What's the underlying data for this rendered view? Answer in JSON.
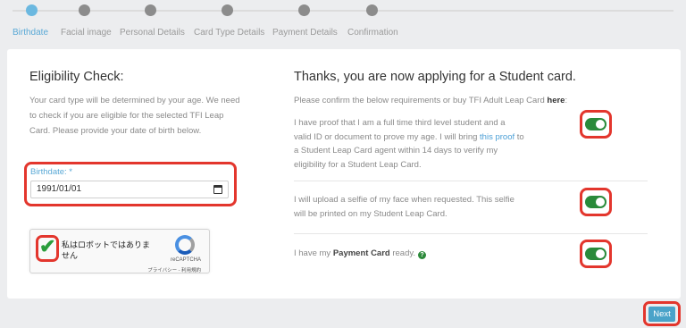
{
  "stepper": {
    "steps": [
      {
        "label": "Birthdate",
        "active": true
      },
      {
        "label": "Facial image",
        "active": false
      },
      {
        "label": "Personal Details",
        "active": false
      },
      {
        "label": "Card Type Details",
        "active": false
      },
      {
        "label": "Payment Details",
        "active": false
      },
      {
        "label": "Confirmation",
        "active": false
      }
    ]
  },
  "eligibility": {
    "title": "Eligibility Check:",
    "description": "Your card type will be determined by your age. We need to check if you are eligible for the selected TFI Leap Card. Please provide your date of birth below.",
    "birthdate_label": "Birthdate: *",
    "birthdate_value": "1991/01/01"
  },
  "recaptcha": {
    "text": "私はロボットではありません",
    "brand": "reCAPTCHA",
    "links": "プライバシー - 利用規約",
    "checked": true
  },
  "student": {
    "title": "Thanks, you are now applying for a Student card.",
    "confirm_prefix": "Please confirm the below requirements or buy TFI Adult Leap Card ",
    "confirm_link": "here",
    "confirm_suffix": ":",
    "req1_before": "I have proof that I am a full time third level student and a valid ID or document to prove my age. I will bring ",
    "req1_link": "this proof",
    "req1_after": " to a Student Leap Card agent within 14 days to verify my eligibility for a Student Leap Card.",
    "req2": "I will upload a selfie of my face when requested. This selfie will be printed on my Student Leap Card.",
    "req3_before": "I have my ",
    "req3_bold": "Payment Card",
    "req3_after": " ready.",
    "help_glyph": "?"
  },
  "toggles": [
    true,
    true,
    true
  ],
  "next_label": "Next",
  "colors": {
    "accent": "#5aa9d6",
    "toggle_on": "#2a8a3a",
    "highlight": "#e3362d",
    "next_button": "#4aa3c9"
  }
}
